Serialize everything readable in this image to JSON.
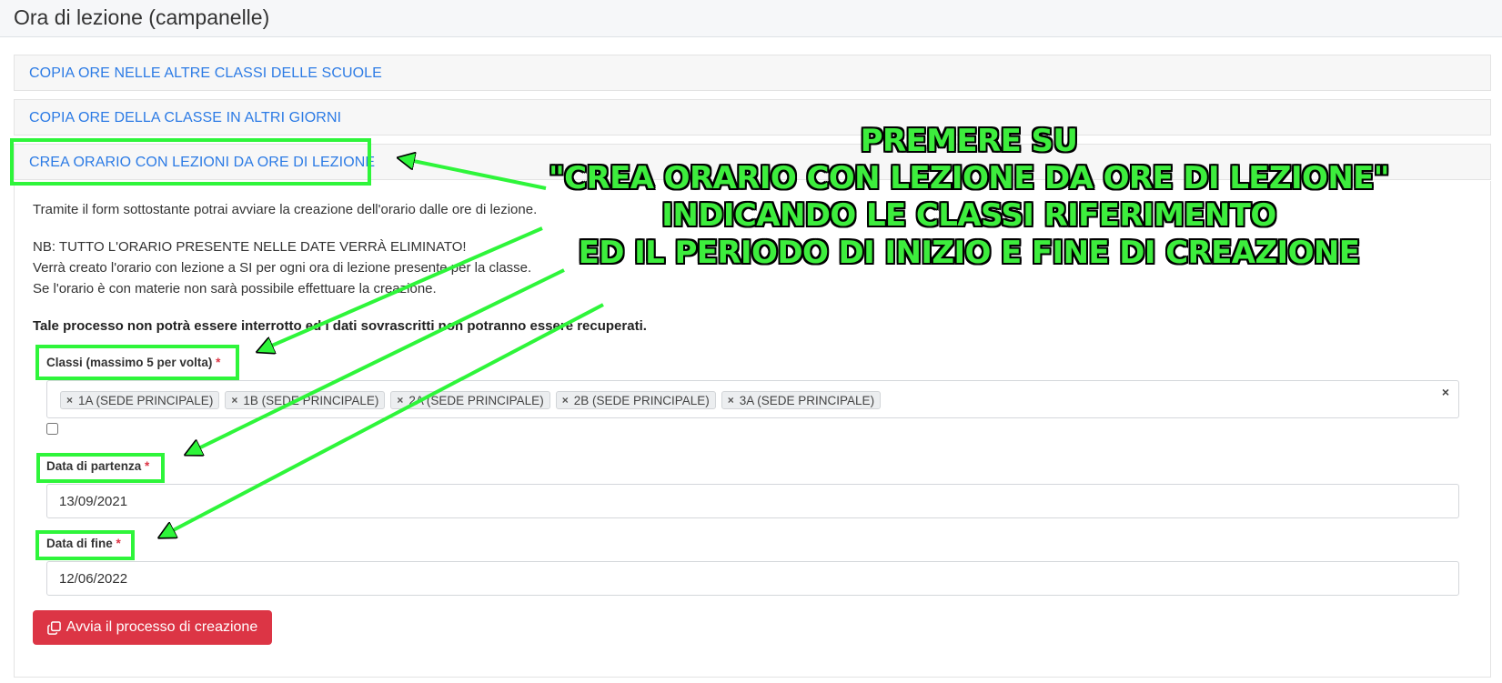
{
  "header": {
    "title": "Ora di lezione (campanelle)"
  },
  "accordion": {
    "item1": "COPIA ORE NELLE ALTRE CLASSI DELLE SCUOLE",
    "item2": "COPIA ORE DELLA CLASSE IN ALTRI GIORNI",
    "item3": "CREA ORARIO CON LEZIONI DA ORE DI LEZIONE"
  },
  "body": {
    "intro": "Tramite il form sottostante potrai avviare la creazione dell'orario dalle ore di lezione.",
    "nb_line1": "NB: TUTTO L'ORARIO PRESENTE NELLE DATE VERRÀ ELIMINATO!",
    "nb_line2": "Verrà creato l'orario con lezione a SI per ogni ora di lezione presente per la classe.",
    "nb_line3": "Se l'orario è con materie non sarà possibile effettuare la creazione.",
    "warning": "Tale processo non potrà essere interrotto ed i dati sovrascritti non potranno essere recuperati."
  },
  "form": {
    "classi_label": "Classi (massimo 5 per volta)",
    "required_mark": "*",
    "chip_remove": "×",
    "clear_all": "×",
    "classi_selected": [
      "1A (SEDE PRINCIPALE)",
      "1B (SEDE PRINCIPALE)",
      "2A (SEDE PRINCIPALE)",
      "2B (SEDE PRINCIPALE)",
      "3A (SEDE PRINCIPALE)"
    ],
    "data_partenza_label": "Data di partenza",
    "data_partenza_value": "13/09/2021",
    "data_fine_label": "Data di fine",
    "data_fine_value": "12/06/2022",
    "submit_label": "Avvia il processo di creazione",
    "submit_icon": "copy-icon"
  },
  "annotation": {
    "lines": [
      "PREMERE SU",
      "\"CREA ORARIO CON LEZIONE DA ORE DI LEZIONE\"",
      "INDICANDO LE CLASSI RIFERIMENTO",
      "ED IL PERIODO DI INIZIO E FINE DI CREAZIONE"
    ],
    "color": "#2ef53a"
  },
  "colors": {
    "link": "#2c7be5",
    "danger": "#dc3545",
    "highlight": "#2ef53a"
  }
}
